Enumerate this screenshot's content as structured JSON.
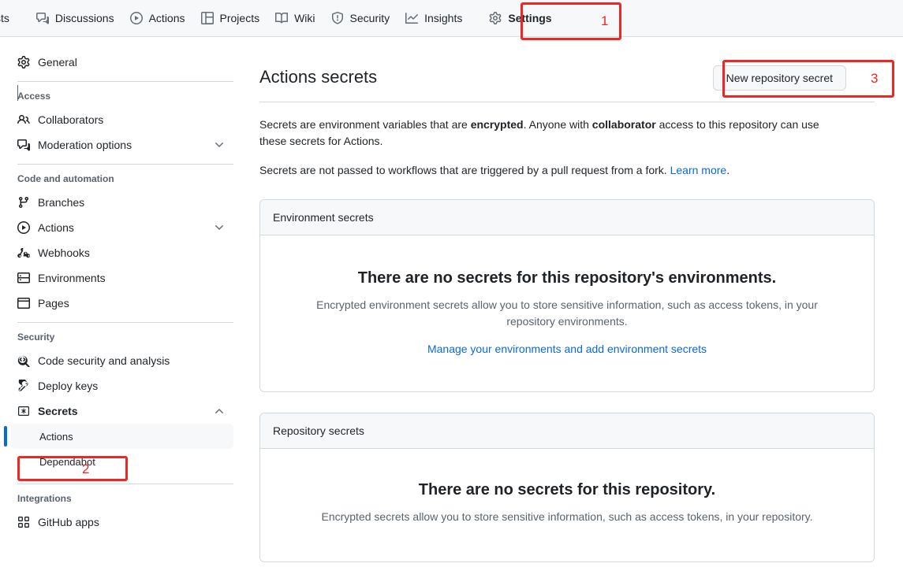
{
  "topnav": {
    "items": [
      {
        "label": "sts",
        "icon": "none",
        "truncated": true
      },
      {
        "label": "Discussions",
        "icon": "comment-discussion-icon"
      },
      {
        "label": "Actions",
        "icon": "play-icon"
      },
      {
        "label": "Projects",
        "icon": "table-icon"
      },
      {
        "label": "Wiki",
        "icon": "book-icon"
      },
      {
        "label": "Security",
        "icon": "shield-icon"
      },
      {
        "label": "Insights",
        "icon": "graph-icon"
      },
      {
        "label": "Settings",
        "icon": "gear-icon",
        "selected": true
      }
    ]
  },
  "annotations": [
    {
      "number": "1",
      "target": "settings-tab"
    },
    {
      "number": "2",
      "target": "sidebar-secrets-actions"
    },
    {
      "number": "3",
      "target": "new-repository-secret-button"
    }
  ],
  "sidebar": {
    "general": {
      "label": "General",
      "icon": "gear-icon"
    },
    "sections": [
      {
        "heading": "Access",
        "items": [
          {
            "label": "Collaborators",
            "icon": "people-icon",
            "expandable": false
          },
          {
            "label": "Moderation options",
            "icon": "comment-discussion-icon",
            "expandable": true,
            "expanded": false
          }
        ]
      },
      {
        "heading": "Code and automation",
        "items": [
          {
            "label": "Branches",
            "icon": "git-branch-icon",
            "expandable": false
          },
          {
            "label": "Actions",
            "icon": "play-icon",
            "expandable": true,
            "expanded": false
          },
          {
            "label": "Webhooks",
            "icon": "webhook-icon",
            "expandable": false
          },
          {
            "label": "Environments",
            "icon": "server-icon",
            "expandable": false
          },
          {
            "label": "Pages",
            "icon": "browser-icon",
            "expandable": false
          }
        ]
      },
      {
        "heading": "Security",
        "items": [
          {
            "label": "Code security and analysis",
            "icon": "codescan-icon",
            "expandable": false
          },
          {
            "label": "Deploy keys",
            "icon": "key-icon",
            "expandable": false
          },
          {
            "label": "Secrets",
            "icon": "asterisk-key-icon",
            "expandable": true,
            "expanded": true,
            "bold": true
          }
        ],
        "subitems": [
          {
            "label": "Actions",
            "active": true
          },
          {
            "label": "Dependabot",
            "active": false
          }
        ]
      },
      {
        "heading": "Integrations",
        "items": [
          {
            "label": "GitHub apps",
            "icon": "apps-icon",
            "expandable": false
          }
        ]
      }
    ]
  },
  "main": {
    "title": "Actions secrets",
    "new_secret_button": "New repository secret",
    "paragraph1": {
      "part1": "Secrets are environment variables that are ",
      "bold1": "encrypted",
      "part2": ". Anyone with ",
      "bold2": "collaborator",
      "part3": " access to this repository can use these secrets for Actions."
    },
    "paragraph2": {
      "text": "Secrets are not passed to workflows that are triggered by a pull request from a fork. ",
      "link": "Learn more",
      "suffix": "."
    },
    "environment_panel": {
      "header": "Environment secrets",
      "blank_title": "There are no secrets for this repository's environments.",
      "blank_sub": "Encrypted environment secrets allow you to store sensitive information, such as access tokens, in your repository environments.",
      "blank_link": "Manage your environments and add environment secrets"
    },
    "repository_panel": {
      "header": "Repository secrets",
      "blank_title": "There are no secrets for this repository.",
      "blank_sub": "Encrypted secrets allow you to store sensitive information, such as access tokens, in your repository."
    }
  },
  "colors": {
    "accent_blue": "#0969da",
    "annotation_red": "#ee2722",
    "header_bg": "#f6f8fa",
    "border": "#d1d9e0",
    "muted_text": "#59636e"
  }
}
